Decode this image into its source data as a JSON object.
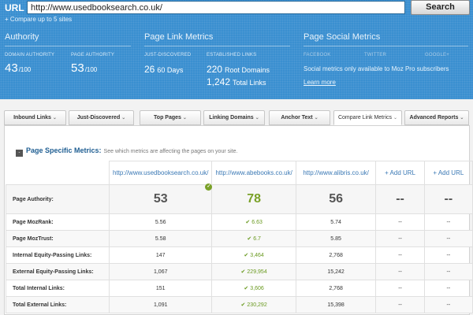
{
  "header": {
    "url_label": "URL",
    "url_value": "http://www.usedbooksearch.co.uk/",
    "search_button": "Search",
    "compare_link": "+ Compare up to 5 sites"
  },
  "authority": {
    "title": "Authority",
    "domain_label": "DOMAIN AUTHORITY",
    "domain_value": "43",
    "domain_suffix": "/100",
    "page_label": "PAGE AUTHORITY",
    "page_value": "53",
    "page_suffix": "/100"
  },
  "page_link_metrics": {
    "title": "Page Link Metrics",
    "just_discovered_label": "JUST-DISCOVERED",
    "just_discovered_value": "26",
    "just_discovered_unit": "60 Days",
    "established_label": "ESTABLISHED LINKS",
    "root_domains_value": "220",
    "root_domains_unit": "Root Domains",
    "total_links_value": "1,242",
    "total_links_unit": "Total Links"
  },
  "social": {
    "title": "Page Social Metrics",
    "facebook": "FACEBOOK",
    "twitter": "TWITTER",
    "google": "GOOGLE+",
    "message": "Social metrics only available to Moz Pro subscribers",
    "learn_more": "Learn more"
  },
  "tabs": [
    {
      "label": "Inbound Links"
    },
    {
      "label": "Just-Discovered"
    },
    {
      "label": "Top Pages"
    },
    {
      "label": "Linking Domains"
    },
    {
      "label": "Anchor Text"
    },
    {
      "label": "Compare Link Metrics"
    },
    {
      "label": "Advanced Reports"
    }
  ],
  "psm": {
    "toggle": "-",
    "title": "Page Specific Metrics:",
    "description": "See which metrics are affecting the pages on your site."
  },
  "table": {
    "columns": [
      {
        "label": "http://www.usedbooksearch.co.uk/"
      },
      {
        "label": "http://www.abebooks.co.uk/"
      },
      {
        "label": "http://www.alibris.co.uk/"
      },
      {
        "label": "+ Add URL"
      },
      {
        "label": "+ Add URL"
      }
    ],
    "page_authority": {
      "label": "Page Authority:",
      "values": [
        "53",
        "78",
        "56",
        "--",
        "--"
      ]
    },
    "rows": [
      {
        "label": "Page MozRank:",
        "values": [
          "5.56",
          "6.63",
          "5.74",
          "--",
          "--"
        ]
      },
      {
        "label": "Page MozTrust:",
        "values": [
          "5.58",
          "6.7",
          "5.85",
          "--",
          "--"
        ]
      },
      {
        "label": "Internal Equity-Passing Links:",
        "values": [
          "147",
          "3,464",
          "2,768",
          "--",
          "--"
        ]
      },
      {
        "label": "External Equity-Passing Links:",
        "values": [
          "1,067",
          "229,954",
          "15,242",
          "--",
          "--"
        ]
      },
      {
        "label": "Total Internal Links:",
        "values": [
          "151",
          "3,606",
          "2,768",
          "--",
          "--"
        ]
      },
      {
        "label": "Total External Links:",
        "values": [
          "1,091",
          "230,292",
          "15,398",
          "--",
          "--"
        ]
      }
    ]
  },
  "colors": {
    "header_blue": "#3a8fd0",
    "link_blue": "#3b79b5",
    "best_green": "#7aa128"
  }
}
